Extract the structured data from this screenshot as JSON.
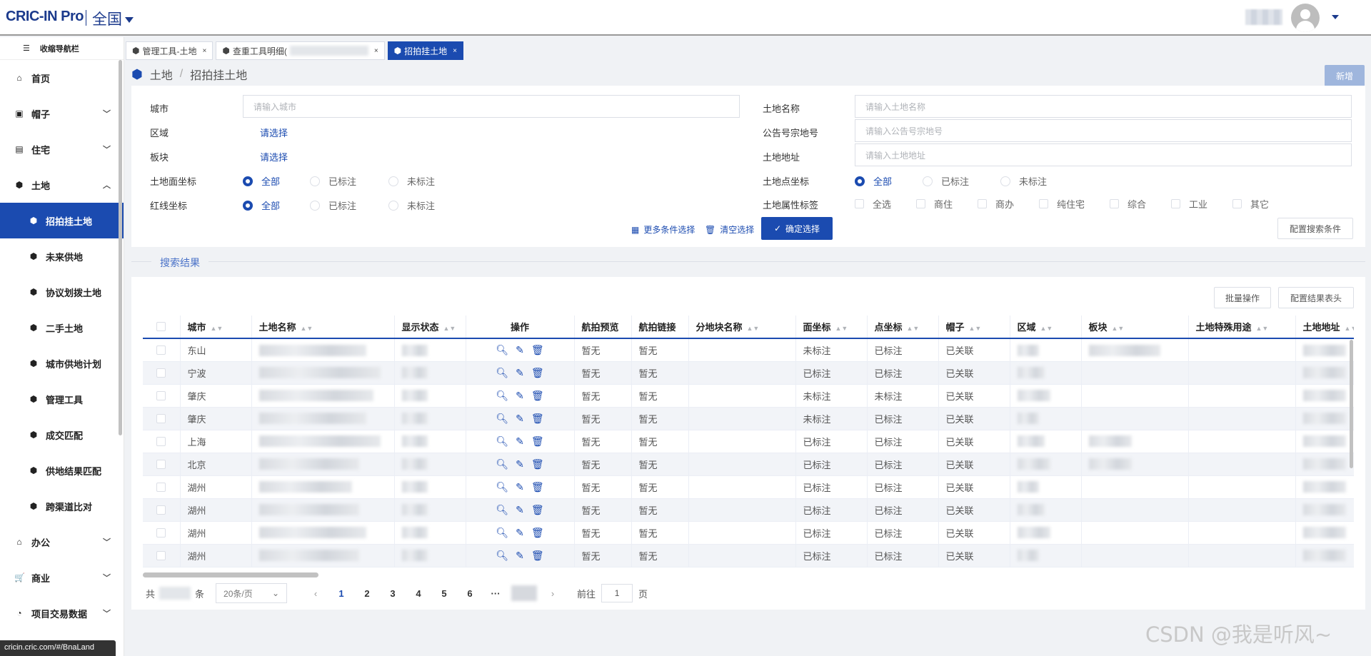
{
  "header": {
    "logo": "CRIC-IN Pro",
    "region": "全国"
  },
  "sidebar": {
    "collapse_label": "收缩导航栏",
    "items": [
      {
        "label": "首页",
        "icon": "home-icon",
        "level": 1,
        "expandable": false
      },
      {
        "label": "帽子",
        "icon": "hat-icon",
        "level": 1,
        "expandable": true
      },
      {
        "label": "住宅",
        "icon": "document-icon",
        "level": 1,
        "expandable": true
      },
      {
        "label": "土地",
        "icon": "cube-icon",
        "level": 1,
        "expandable": true,
        "expanded": true
      },
      {
        "label": "招拍挂土地",
        "icon": "cube-icon",
        "level": 2,
        "active": true
      },
      {
        "label": "未来供地",
        "icon": "cube-icon",
        "level": 2
      },
      {
        "label": "协议划拨土地",
        "icon": "cube-icon",
        "level": 2
      },
      {
        "label": "二手土地",
        "icon": "cube-icon",
        "level": 2
      },
      {
        "label": "城市供地计划",
        "icon": "cube-icon",
        "level": 2
      },
      {
        "label": "管理工具",
        "icon": "cube-icon",
        "level": 2
      },
      {
        "label": "成交匹配",
        "icon": "cube-icon",
        "level": 2
      },
      {
        "label": "供地结果匹配",
        "icon": "cube-icon",
        "level": 2
      },
      {
        "label": "跨渠道比对",
        "icon": "cube-icon",
        "level": 2
      },
      {
        "label": "办公",
        "icon": "bank-icon",
        "level": 1,
        "expandable": true
      },
      {
        "label": "商业",
        "icon": "cart-icon",
        "level": 1,
        "expandable": true
      },
      {
        "label": "项目交易数据",
        "icon": "gauge-icon",
        "level": 1,
        "expandable": true
      }
    ]
  },
  "status_url": "cricin.cric.com/#/BnaLand",
  "tabs": [
    {
      "label": "管理工具-土地",
      "active": false
    },
    {
      "label": "查重工具明细(",
      "active": false,
      "blurred": true
    },
    {
      "label": "招拍挂土地",
      "active": true
    }
  ],
  "breadcrumb": {
    "root": "土地",
    "separator": "/",
    "current": "招拍挂土地"
  },
  "new_button": "新增",
  "filters": {
    "city": {
      "label": "城市",
      "placeholder": "请输入城市"
    },
    "area": {
      "label": "区域",
      "link": "请选择"
    },
    "block": {
      "label": "板块",
      "link": "请选择"
    },
    "surface_coord": {
      "label": "土地面坐标",
      "options": [
        "全部",
        "已标注",
        "未标注"
      ],
      "selected": "全部"
    },
    "redline_coord": {
      "label": "红线坐标",
      "options": [
        "全部",
        "已标注",
        "未标注"
      ],
      "selected": "全部"
    },
    "land_name": {
      "label": "土地名称",
      "placeholder": "请输入土地名称"
    },
    "notice_no": {
      "label": "公告号宗地号",
      "placeholder": "请输入公告号宗地号"
    },
    "land_addr": {
      "label": "土地地址",
      "placeholder": "请输入土地地址"
    },
    "point_coord": {
      "label": "土地点坐标",
      "options": [
        "全部",
        "已标注",
        "未标注"
      ],
      "selected": "全部"
    },
    "attr_tags": {
      "label": "土地属性标签",
      "options": [
        "全选",
        "商住",
        "商办",
        "纯住宅",
        "综合",
        "工业",
        "其它"
      ]
    }
  },
  "actions": {
    "more": "更多条件选择",
    "clear": "清空选择",
    "confirm": "确定选择",
    "config_search": "配置搜索条件"
  },
  "results": {
    "label": "搜索结果",
    "batch": "批量操作",
    "config_head": "配置结果表头",
    "columns": [
      "城市",
      "土地名称",
      "显示状态",
      "操作",
      "航拍预览",
      "航拍链接",
      "分地块名称",
      "面坐标",
      "点坐标",
      "帽子",
      "区域",
      "板块",
      "土地特殊用途",
      "土地地址"
    ],
    "rows": [
      {
        "city": "东山",
        "aerial_preview": "暂无",
        "aerial_link": "暂无",
        "surface": "未标注",
        "point": "已标注",
        "hat": "已关联"
      },
      {
        "city": "宁波",
        "aerial_preview": "暂无",
        "aerial_link": "暂无",
        "surface": "已标注",
        "point": "已标注",
        "hat": "已关联"
      },
      {
        "city": "肇庆",
        "aerial_preview": "暂无",
        "aerial_link": "暂无",
        "surface": "未标注",
        "point": "未标注",
        "hat": "已关联"
      },
      {
        "city": "肇庆",
        "aerial_preview": "暂无",
        "aerial_link": "暂无",
        "surface": "未标注",
        "point": "已标注",
        "hat": "已关联"
      },
      {
        "city": "上海",
        "aerial_preview": "暂无",
        "aerial_link": "暂无",
        "surface": "已标注",
        "point": "已标注",
        "hat": "已关联"
      },
      {
        "city": "北京",
        "aerial_preview": "暂无",
        "aerial_link": "暂无",
        "surface": "已标注",
        "point": "已标注",
        "hat": "已关联"
      },
      {
        "city": "湖州",
        "aerial_preview": "暂无",
        "aerial_link": "暂无",
        "surface": "已标注",
        "point": "已标注",
        "hat": "已关联"
      },
      {
        "city": "湖州",
        "aerial_preview": "暂无",
        "aerial_link": "暂无",
        "surface": "已标注",
        "point": "已标注",
        "hat": "已关联"
      },
      {
        "city": "湖州",
        "aerial_preview": "暂无",
        "aerial_link": "暂无",
        "surface": "已标注",
        "point": "已标注",
        "hat": "已关联"
      },
      {
        "city": "湖州",
        "aerial_preview": "暂无",
        "aerial_link": "暂无",
        "surface": "已标注",
        "point": "已标注",
        "hat": "已关联"
      }
    ]
  },
  "pagination": {
    "total_prefix": "共",
    "total_suffix": "条",
    "page_size": "20条/页",
    "pages": [
      "1",
      "2",
      "3",
      "4",
      "5",
      "6",
      "···"
    ],
    "current_page": "1",
    "goto_prefix": "前往",
    "goto_value": "1",
    "goto_suffix": "页"
  },
  "watermark": "CSDN @我是听风~",
  "colors": {
    "primary": "#1b4bb0",
    "logo": "#1b3a8c",
    "new_button": "#9fb6dd"
  }
}
